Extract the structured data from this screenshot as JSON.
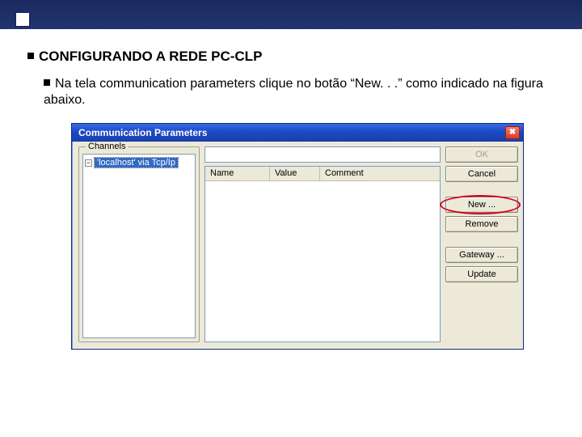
{
  "slide": {
    "title": "CONFIGURANDO A REDE PC-CLP",
    "body": "Na tela communication parameters clique no botão “New. . .” como indicado na figura abaixo."
  },
  "dialog": {
    "title": "Communication Parameters",
    "close_glyph": "✖",
    "channels_legend": "Channels",
    "tree": {
      "expander": "−",
      "selected": "'localhost' via Tcp/Ip"
    },
    "grid": {
      "col_name": "Name",
      "col_value": "Value",
      "col_comment": "Comment"
    },
    "buttons": {
      "ok": "OK",
      "cancel": "Cancel",
      "new": "New ...",
      "remove": "Remove",
      "gateway": "Gateway ...",
      "update": "Update"
    }
  }
}
